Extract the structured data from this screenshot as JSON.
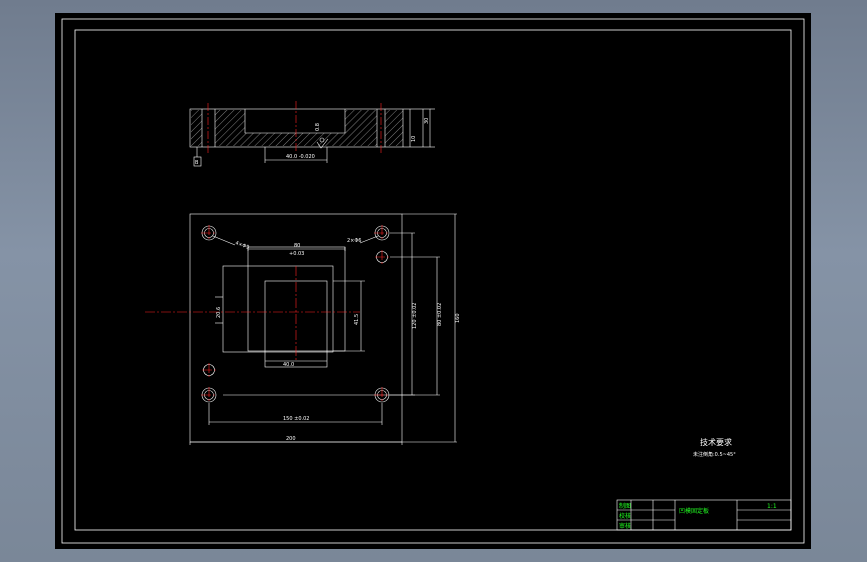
{
  "drawing": {
    "tech_title": "技术要求",
    "tech_note": "未注倒角:0.5~45°",
    "section": {
      "dim_bottom": "40.0 -0.020",
      "dim_right_top": "30",
      "dim_right_bottom": "10",
      "label_small": "0.8",
      "hatch_label": "0.8",
      "datum_box": "B"
    },
    "plan": {
      "hole_callout_left": "4×Φ9",
      "hole_callout_right": "2×Φ6",
      "dim_outer_w": "80",
      "dim_outer_w_tol": "+0.03",
      "dim_outer_h": "20.6",
      "dim_inner_h": "41.5",
      "dim_inner_w": "40.0",
      "dim_hole_spacing_v": "120 ±0.02",
      "dim_hole_pin_v": "80 ±0.02",
      "dim_total_h": "160",
      "dim_hole_spacing_h": "150 ±0.02",
      "dim_total_w": "200"
    },
    "title_block": {
      "part_name": "凹模固定板",
      "scale": "1:1",
      "row_labels": [
        "制图",
        "校核",
        "审核"
      ]
    }
  }
}
